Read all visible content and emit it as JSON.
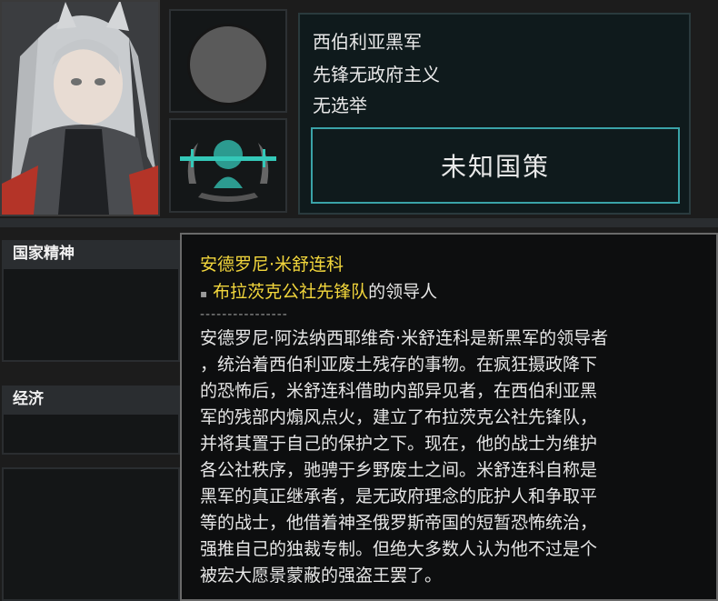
{
  "leader": {
    "faction_line1": "西伯利亚黑军",
    "ideology_line": "先锋无政府主义",
    "election_line": "无选举",
    "national_focus": "未知国策"
  },
  "sections": {
    "national_spirit": "国家精神",
    "economy": "经济"
  },
  "tooltip": {
    "name": "安德罗尼·米舒连科",
    "role_prefix_mark": "▪",
    "role_highlight": "布拉茨克公社先锋队",
    "role_suffix": "的领导人",
    "separator": "----------------",
    "description_lines": [
      "安德罗尼·阿法纳西耶维奇·米舒连科是新黑军的领导者",
      "，统治着西伯利亚废土残存的事物。在疯狂摄政降下",
      "的恐怖后，米舒连科借助内部异见者，在西伯利亚黑",
      "军的残部内煽风点火，建立了布拉茨克公社先锋队，",
      "并将其置于自己的保护之下。现在，他的战士为维护",
      "各公社秩序，驰骋于乡野废土之间。米舒连科自称是",
      "黑军的真正继承者，是无政府理念的庇护人和争取平",
      "等的战士，他借着神圣俄罗斯帝国的短暂恐怖统治，",
      "强推自己的独裁专制。但绝大多数人认为他不过是个",
      "被宏大愿景蒙蔽的强盗王罢了。"
    ]
  },
  "colors": {
    "accent_yellow": "#f2d63c",
    "focus_border": "#3aa3a8",
    "ideology_icon": "#34c8b8"
  },
  "icons": {
    "portrait": "leader-portrait",
    "ideology": "ideology-emblem-icon",
    "party": "party-circle-icon"
  }
}
